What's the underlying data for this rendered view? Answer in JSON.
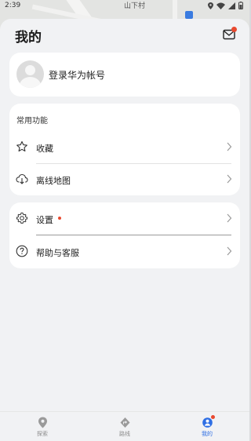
{
  "status_bar": {
    "time": "2:39"
  },
  "map": {
    "label": "山下村"
  },
  "header": {
    "title": "我的"
  },
  "account": {
    "login_text": "登录华为帐号"
  },
  "common": {
    "section_label": "常用功能",
    "items": [
      {
        "label": "收藏",
        "icon": "star-icon"
      },
      {
        "label": "离线地图",
        "icon": "cloud-download-icon"
      }
    ]
  },
  "settings": {
    "items": [
      {
        "label": "设置",
        "icon": "gear-icon",
        "has_badge": true
      },
      {
        "label": "帮助与客服",
        "icon": "help-icon"
      }
    ]
  },
  "bottom_nav": {
    "items": [
      {
        "label": "探索",
        "icon": "location-pin-icon",
        "active": false
      },
      {
        "label": "路线",
        "icon": "route-icon",
        "active": false
      },
      {
        "label": "我的",
        "icon": "profile-icon",
        "active": true
      }
    ]
  },
  "colors": {
    "accent": "#2f6fe4",
    "badge": "#e8492f",
    "sheet_background": "#f1f2f4",
    "card_background": "#ffffff"
  }
}
